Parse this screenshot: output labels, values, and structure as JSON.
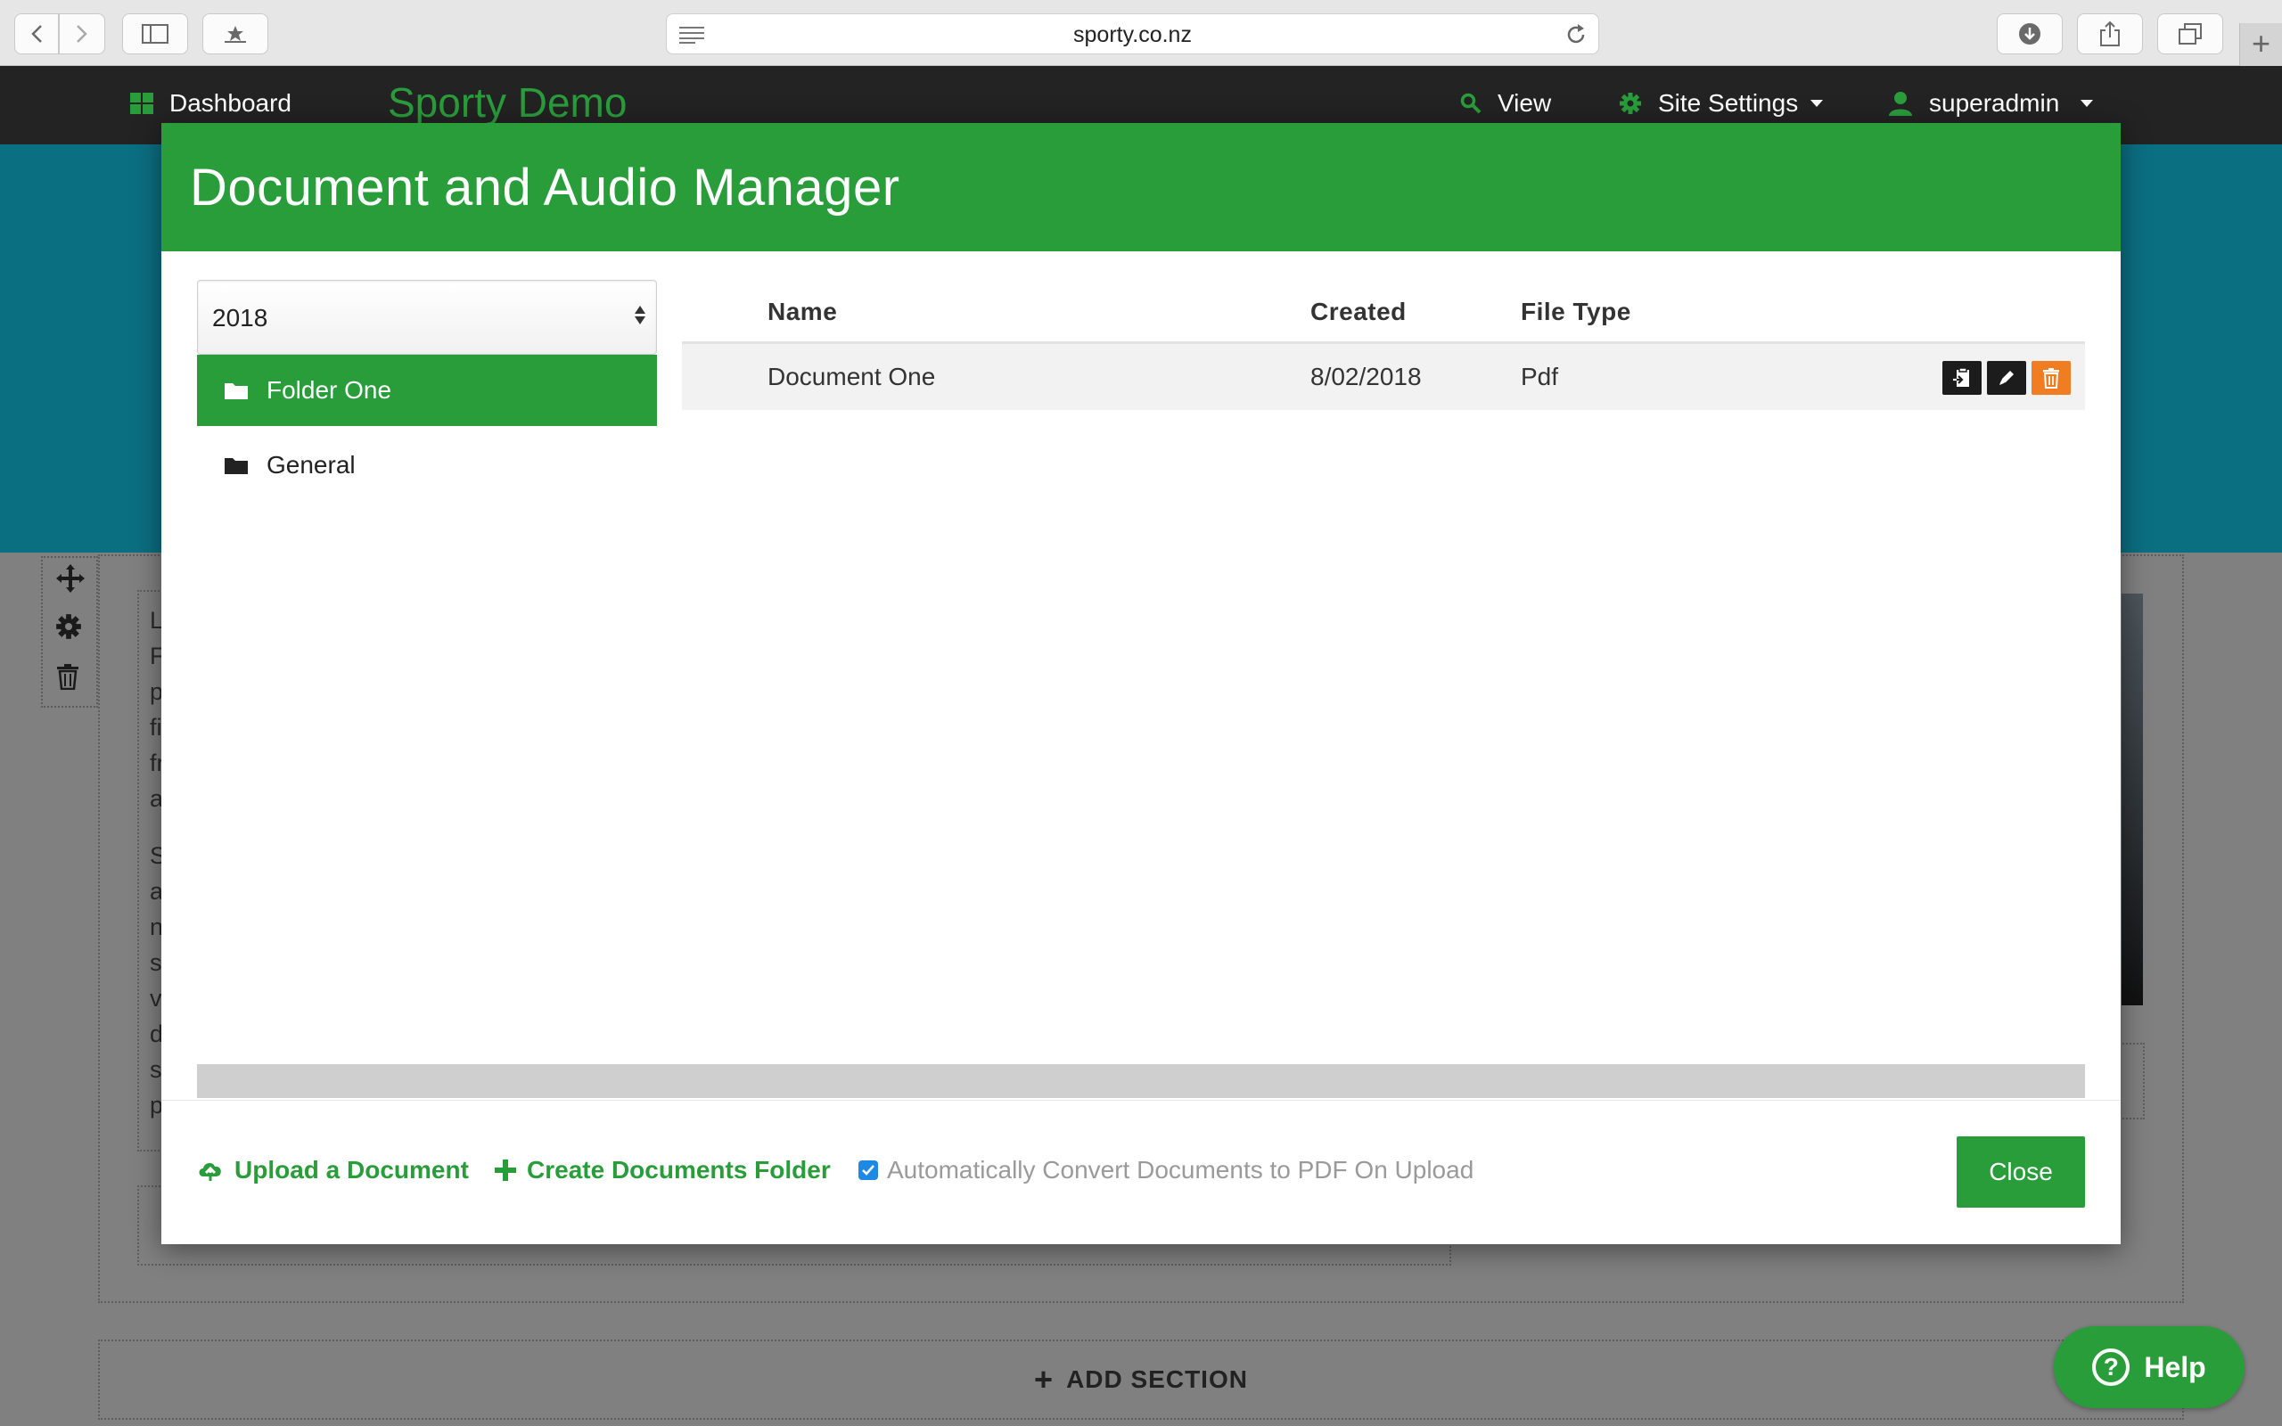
{
  "browser": {
    "url": "sporty.co.nz"
  },
  "site_nav": {
    "dashboard_label": "Dashboard",
    "brand": "Sporty Demo",
    "view_label": "View",
    "settings_label": "Site Settings",
    "user_label": "superadmin"
  },
  "background": {
    "letters": [
      "L",
      "F",
      "p",
      "fi",
      "fr",
      "a",
      "",
      "S",
      "a",
      "n",
      "s",
      "v",
      "d",
      "s",
      "p"
    ],
    "add_section_label": "ADD SECTION",
    "help_label": "Help"
  },
  "modal": {
    "title": "Document and Audio Manager",
    "year_selected": "2018",
    "folders": [
      {
        "label": "Folder One",
        "active": true
      },
      {
        "label": "General",
        "active": false
      }
    ],
    "table": {
      "headers": [
        "Name",
        "Created",
        "File Type"
      ],
      "rows": [
        {
          "name": "Document One",
          "created": "8/02/2018",
          "type": "Pdf"
        }
      ]
    },
    "footer": {
      "upload_label": "Upload a Document",
      "create_folder_label": "Create Documents Folder",
      "auto_convert_label": "Automatically Convert Documents to PDF On Upload",
      "auto_convert_checked": true,
      "close_label": "Close"
    }
  },
  "colors": {
    "brand_green": "#2a9d3b",
    "nav_dark": "#232323",
    "hero_teal": "#0b6f82",
    "delete_orange": "#f07d22"
  }
}
